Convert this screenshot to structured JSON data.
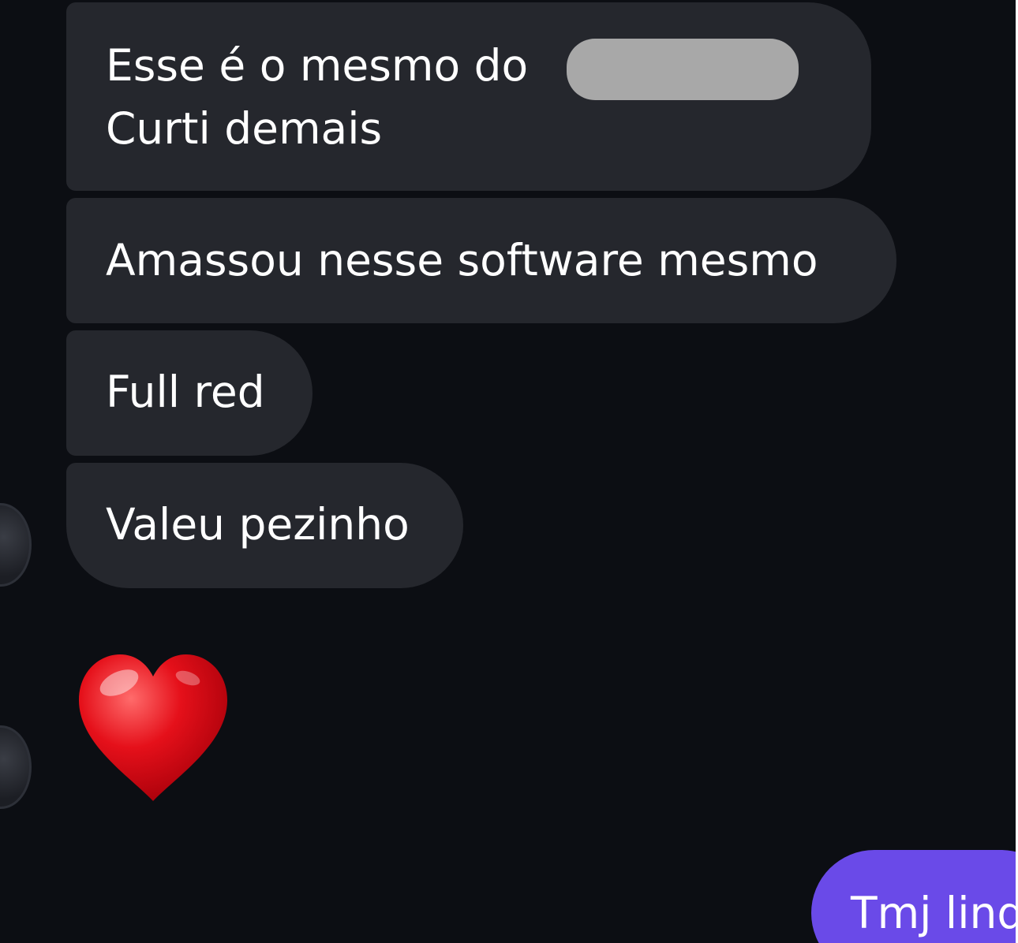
{
  "messages": [
    {
      "lines": [
        "Esse é o mesmo do",
        "Curti demais"
      ],
      "trailing": "?"
    },
    {
      "text": "Amassou nesse software mesmo"
    },
    {
      "text": "Full red"
    },
    {
      "text": "Valeu pezinho"
    }
  ],
  "reaction": {
    "icon": "heart-emoji",
    "color": "#e5101a"
  },
  "sent": {
    "text": "Tmj lind"
  },
  "colors": {
    "background": "#0c0e13",
    "received_bubble": "#25272d",
    "sent_bubble": "#6a4ae8",
    "redaction": "#a8a8a8"
  }
}
